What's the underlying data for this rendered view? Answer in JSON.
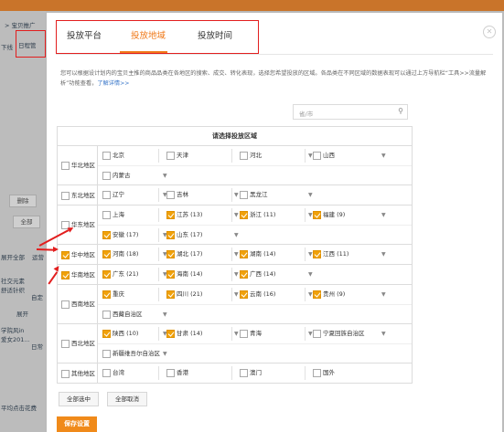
{
  "background": {
    "breadcrumb": "> 宝贝推广",
    "left_labels": [
      "下线",
      "删除",
      "全部",
      "展开全部",
      "运营",
      "社交元素",
      "舒适针织",
      "展开",
      "学院风in",
      "爱女201...",
      "平均点击花费"
    ],
    "right_labels": [
      "自定",
      "日常"
    ],
    "highlighted_tab": "日程管"
  },
  "modal": {
    "tabs": [
      {
        "label": "投放平台",
        "active": false
      },
      {
        "label": "投放地域",
        "active": true
      },
      {
        "label": "投放时间",
        "active": false
      }
    ],
    "close_glyph": "✕",
    "description": "您可以根据设计划内的宝贝主推的商品品类在各地区的搜索、成交、转化表现，选择您希望投放的区域。各品类在不同区域的数据表现可以通过上方导航栏“工具>>流量解析”功能查看，",
    "description_link": "了解详情>>",
    "search": {
      "placeholder": "省/市",
      "icon": "search-icon"
    },
    "table_title": "请选择投放区域",
    "regions": [
      {
        "name": "华北地区",
        "checked": false,
        "lines": [
          [
            {
              "name": "北京",
              "checked": false,
              "caret": false
            },
            {
              "name": "天津",
              "checked": false,
              "caret": false
            },
            {
              "name": "河北",
              "checked": false,
              "caret": true
            },
            {
              "name": "山西",
              "checked": false,
              "caret": true
            }
          ],
          [
            {
              "name": "内蒙古",
              "checked": false,
              "caret": true
            }
          ]
        ]
      },
      {
        "name": "东北地区",
        "checked": false,
        "lines": [
          [
            {
              "name": "辽宁",
              "checked": false,
              "caret": true
            },
            {
              "name": "吉林",
              "checked": false,
              "caret": true
            },
            {
              "name": "黑龙江",
              "checked": false,
              "caret": true
            }
          ]
        ]
      },
      {
        "name": "华东地区",
        "checked": false,
        "lines": [
          [
            {
              "name": "上海",
              "checked": false,
              "caret": false
            },
            {
              "name": "江苏 (13)",
              "checked": true,
              "caret": true
            },
            {
              "name": "浙江 (11)",
              "checked": true,
              "caret": true
            },
            {
              "name": "福建 (9)",
              "checked": true,
              "caret": true
            }
          ],
          [
            {
              "name": "安徽 (17)",
              "checked": true,
              "caret": true
            },
            {
              "name": "山东 (17)",
              "checked": true,
              "caret": true
            }
          ]
        ]
      },
      {
        "name": "华中地区",
        "checked": true,
        "lines": [
          [
            {
              "name": "河南 (18)",
              "checked": true,
              "caret": true
            },
            {
              "name": "湖北 (17)",
              "checked": true,
              "caret": true
            },
            {
              "name": "湖南 (14)",
              "checked": true,
              "caret": true
            },
            {
              "name": "江西 (11)",
              "checked": true,
              "caret": true
            }
          ]
        ]
      },
      {
        "name": "华南地区",
        "checked": true,
        "lines": [
          [
            {
              "name": "广东 (21)",
              "checked": true,
              "caret": true
            },
            {
              "name": "海南 (14)",
              "checked": true,
              "caret": true
            },
            {
              "name": "广西 (14)",
              "checked": true,
              "caret": true
            }
          ]
        ]
      },
      {
        "name": "西南地区",
        "checked": false,
        "lines": [
          [
            {
              "name": "重庆",
              "checked": true,
              "caret": false
            },
            {
              "name": "四川 (21)",
              "checked": true,
              "caret": true
            },
            {
              "name": "云南 (16)",
              "checked": true,
              "caret": true
            },
            {
              "name": "贵州 (9)",
              "checked": true,
              "caret": true
            }
          ],
          [
            {
              "name": "西藏自治区",
              "checked": false,
              "caret": true
            }
          ]
        ]
      },
      {
        "name": "西北地区",
        "checked": false,
        "lines": [
          [
            {
              "name": "陕西 (10)",
              "checked": true,
              "caret": true
            },
            {
              "name": "甘肃 (14)",
              "checked": true,
              "caret": true
            },
            {
              "name": "青海",
              "checked": false,
              "caret": true
            },
            {
              "name": "宁夏回族自治区",
              "checked": false,
              "caret": true
            }
          ],
          [
            {
              "name": "新疆维吾尔自治区",
              "checked": false,
              "caret": true
            }
          ]
        ]
      },
      {
        "name": "其他地区",
        "checked": false,
        "lines": [
          [
            {
              "name": "台湾",
              "checked": false,
              "caret": false
            },
            {
              "name": "香港",
              "checked": false,
              "caret": false
            },
            {
              "name": "澳门",
              "checked": false,
              "caret": false
            },
            {
              "name": "国外",
              "checked": false,
              "caret": false
            }
          ]
        ]
      }
    ],
    "select_all_label": "全部选中",
    "cancel_all_label": "全部取消",
    "save_label": "保存设置"
  }
}
